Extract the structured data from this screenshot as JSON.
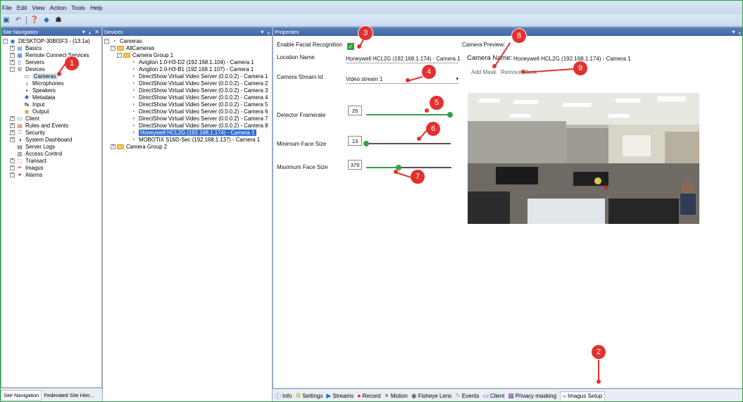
{
  "menu": [
    "File",
    "Edit",
    "View",
    "Action",
    "Tools",
    "Help"
  ],
  "site_nav": {
    "title": "Site Navigation",
    "tabs": [
      "Site Navigation",
      "Federated Site Hier..."
    ],
    "items": [
      {
        "label": "DESKTOP-30BISF3 - (13.1a)",
        "level": 0
      },
      {
        "label": "Basics",
        "level": 1
      },
      {
        "label": "Remote Connect Services",
        "level": 1
      },
      {
        "label": "Servers",
        "level": 1
      },
      {
        "label": "Devices",
        "level": 1
      },
      {
        "label": "Cameras",
        "level": 2
      },
      {
        "label": "Microphones",
        "level": 2
      },
      {
        "label": "Speakers",
        "level": 2
      },
      {
        "label": "Metadata",
        "level": 2
      },
      {
        "label": "Input",
        "level": 2
      },
      {
        "label": "Output",
        "level": 2
      },
      {
        "label": "Client",
        "level": 1
      },
      {
        "label": "Rules and Events",
        "level": 1
      },
      {
        "label": "Security",
        "level": 1
      },
      {
        "label": "System Dashboard",
        "level": 1
      },
      {
        "label": "Server Logs",
        "level": 1
      },
      {
        "label": "Access Control",
        "level": 1
      },
      {
        "label": "Transact",
        "level": 1
      },
      {
        "label": "Imagus",
        "level": 1
      },
      {
        "label": "Alarms",
        "level": 1
      }
    ]
  },
  "devices": {
    "title": "Devices",
    "root": "Cameras",
    "all": "AllCameras",
    "group1": "Camera Group 1",
    "group2": "Camera Group 2",
    "cameras": [
      "Avigilon 1.0-H3-D2 (192.168.1.104) - Camera 1",
      "Avigilon 2.0-H3-B1 (192.168.1.107) - Camera 1",
      "DirectShow Virtual Video Server (0.0.0.2) - Camera 1",
      "DirectShow Virtual Video Server (0.0.0.2) - Camera 2",
      "DirectShow Virtual Video Server (0.0.0.2) - Camera 3",
      "DirectShow Virtual Video Server (0.0.0.2) - Camera 4",
      "DirectShow Virtual Video Server (0.0.0.2) - Camera 5",
      "DirectShow Virtual Video Server (0.0.0.2) - Camera 6",
      "DirectShow Virtual Video Server (0.0.0.2) - Camera 7",
      "DirectShow Virtual Video Server (0.0.0.2) - Camera 8",
      "Honeywell HCL2G (192.168.1.174) - Camera 1",
      "MOBOTIX S16D-Sec (192.168.1.137) - Camera 1"
    ]
  },
  "properties": {
    "title": "Properties",
    "enable_facial_label": "Enable Facial Recognition",
    "location_label": "Location Name",
    "location_value": "Honeywell HCL2G (192.168.1.174) - Camera 1",
    "stream_label": "Camera Stream Id",
    "stream_value": "Video stream 1",
    "framerate_label": "Detector Framerate",
    "framerate_value": "25",
    "framerate_level": 1.0,
    "min_face_label": "Minimum Face Size",
    "min_face_value": "13",
    "min_face_level": 0.0,
    "max_face_label": "Maximum Face Size",
    "max_face_value": "379",
    "max_face_level": 0.38,
    "preview_label": "Camera Preview:",
    "camera_name_label": "Camera Name:",
    "camera_name_value": "Honeywell HCL2G (192.168.1.174) - Camera 1",
    "add_mask": "Add Mask",
    "remove_mask": "Remove Mask"
  },
  "bottom_tabs": [
    {
      "label": "Info",
      "icon": "info-icon"
    },
    {
      "label": "Settings",
      "icon": "settings-icon"
    },
    {
      "label": "Streams",
      "icon": "streams-icon"
    },
    {
      "label": "Record",
      "icon": "record-icon"
    },
    {
      "label": "Motion",
      "icon": "motion-icon"
    },
    {
      "label": "Fisheye Lens",
      "icon": "fisheye-icon"
    },
    {
      "label": "Events",
      "icon": "events-icon"
    },
    {
      "label": "Client",
      "icon": "client-icon"
    },
    {
      "label": "Privacy masking",
      "icon": "privacy-icon"
    },
    {
      "label": "Imagus Setup",
      "icon": "imagus-icon"
    }
  ],
  "markers": [
    "1",
    "2",
    "3",
    "4",
    "5",
    "6",
    "7",
    "8",
    "9"
  ],
  "colors": {
    "marker": "#e33030",
    "selection": "#2f6ecb",
    "slider": "#3aa043"
  }
}
